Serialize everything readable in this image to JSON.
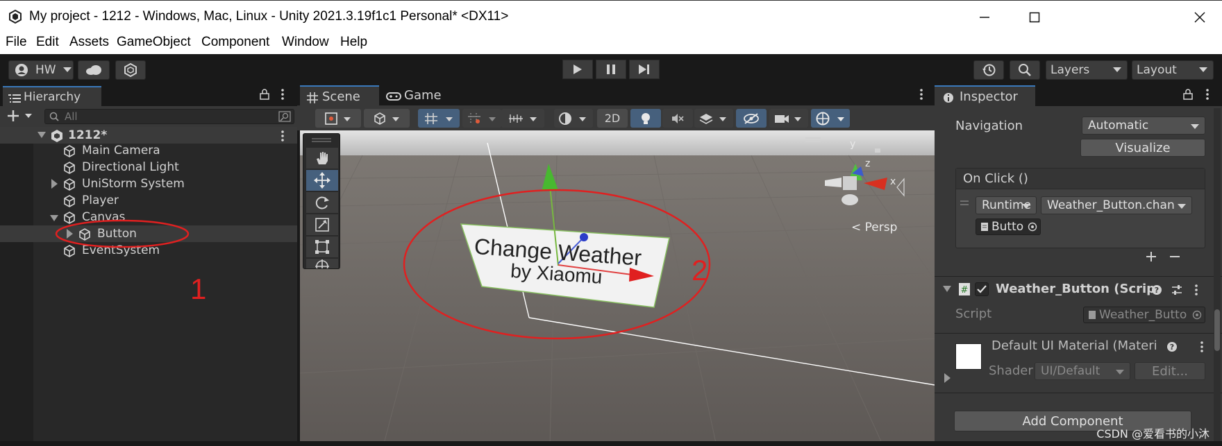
{
  "window": {
    "title": "My project - 1212 - Windows, Mac, Linux - Unity 2021.3.19f1c1 Personal* <DX11>"
  },
  "menu": [
    "File",
    "Edit",
    "Assets",
    "GameObject",
    "Component",
    "Window",
    "Help"
  ],
  "toolbar": {
    "account": "HW",
    "layers": "Layers",
    "layout": "Layout"
  },
  "hierarchy": {
    "tab": "Hierarchy",
    "search_placeholder": "All",
    "scene": "1212*",
    "items": [
      "Main Camera",
      "Directional Light",
      "UniStorm System",
      "Player",
      "Canvas",
      "Button",
      "EventSystem"
    ],
    "annotation": "1"
  },
  "scene_panel": {
    "tabs": [
      "Scene",
      "Game"
    ],
    "mode_2d": "2D",
    "persp": "< Persp",
    "gizmo_axes": [
      "y",
      "z",
      "x"
    ],
    "button_text_line1": "Change Weather",
    "button_text_line2": "by Xiaomu",
    "annotation": "2"
  },
  "inspector": {
    "tab": "Inspector",
    "navigation_label": "Navigation",
    "navigation_value": "Automatic",
    "visualize": "Visualize",
    "onclick_header": "On Click ()",
    "runtime": "Runtime",
    "function": "Weather_Button.chan",
    "target": "Butto",
    "component_title": "Weather_Button (Scrip",
    "script_label": "Script",
    "script_value": "Weather_Butto",
    "material_title": "Default UI Material (Materi",
    "shader_label": "Shader",
    "shader_value": "UI/Default",
    "edit": "Edit...",
    "add_component": "Add Component"
  },
  "watermark": "CSDN @爱看书的小沐",
  "colors": {
    "accent": "#3a79bb",
    "annotation_red": "#e02020"
  }
}
